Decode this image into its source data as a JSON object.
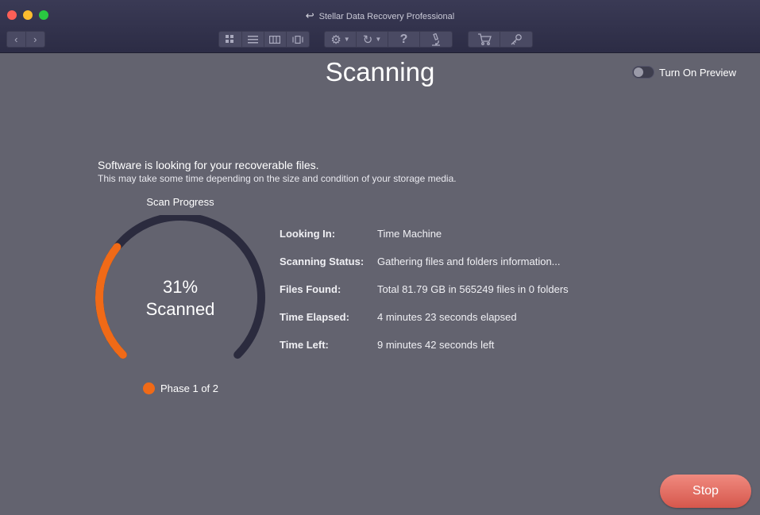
{
  "window": {
    "title": "Stellar Data Recovery Professional"
  },
  "toolbar": {
    "icons": [
      "back-arrow",
      "forward-arrow",
      "grid-view",
      "list-view",
      "column-view",
      "coverflow-view",
      "gear",
      "history",
      "help",
      "scan-probe",
      "cart",
      "key"
    ]
  },
  "main": {
    "heading": "Scanning",
    "preview_label": "Turn On Preview",
    "preview_on": false,
    "message_primary": "Software is looking for your recoverable files.",
    "message_secondary": "This may take some time depending on the size and condition of your storage media.",
    "progress_title": "Scan Progress",
    "progress_percent_text": "31%",
    "progress_fraction": 0.31,
    "progress_suffix": "Scanned",
    "phase_label": "Phase 1 of 2",
    "accent_color": "#f06a17",
    "track_color": "#2b2b3e"
  },
  "details": [
    {
      "label": "Looking In:",
      "value": "Time Machine"
    },
    {
      "label": "Scanning Status:",
      "value": "Gathering files and folders information..."
    },
    {
      "label": "Files Found:",
      "value": "Total 81.79 GB in 565249 files in 0 folders"
    },
    {
      "label": "Time Elapsed:",
      "value": "4 minutes 23 seconds elapsed"
    },
    {
      "label": "Time Left:",
      "value": "9 minutes 42 seconds left"
    }
  ],
  "actions": {
    "stop_label": "Stop"
  }
}
